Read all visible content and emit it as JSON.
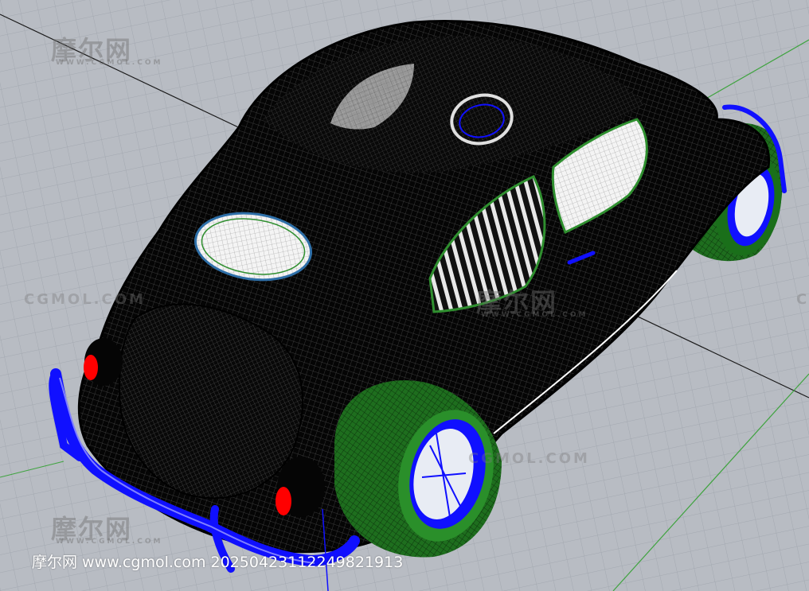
{
  "watermarks": {
    "brand": "摩尔网",
    "url_small": "WWW.CGMOL.COM",
    "url_large": "CGMOL.COM"
  },
  "footer": {
    "caption": "摩尔网 www.cgmol.com 20250423112249821913"
  },
  "colors": {
    "grid_background": "#b8bcc3",
    "grid_line": "#a3a8b0",
    "axis_x": "#1a1a1a",
    "axis_y": "#3fa33f",
    "body_wire": "#000000",
    "tyre_wire": "#2f8f2f",
    "chrome_wire": "#1010ff",
    "tail_light": "#ff0000"
  },
  "icons": {
    "model": "car-wireframe-icon"
  }
}
